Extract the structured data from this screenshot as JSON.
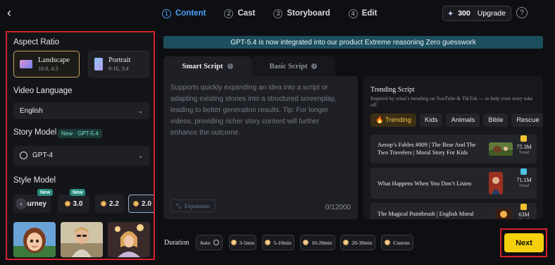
{
  "header": {
    "back_icon": "chevron-left-icon",
    "steps": [
      {
        "num": "1",
        "label": "Content"
      },
      {
        "num": "2",
        "label": "Cast"
      },
      {
        "num": "3",
        "label": "Storyboard"
      },
      {
        "num": "4",
        "label": "Edit"
      }
    ],
    "active_step": 1,
    "credits": "300",
    "upgrade_label": "Upgrade",
    "help_label": "?"
  },
  "left_panel": {
    "aspect_ratio": {
      "title": "Aspect Ratio",
      "options": [
        {
          "name": "Landscape",
          "ratio": "16:9, 4:3",
          "selected": true
        },
        {
          "name": "Portrait",
          "ratio": "9:16, 3:4",
          "selected": false
        }
      ]
    },
    "video_language": {
      "title": "Video Language",
      "value": "English"
    },
    "story_model": {
      "title": "Story Model",
      "badge": "New · GPT-5.4",
      "value": "GPT-4"
    },
    "style_model": {
      "title": "Style Model",
      "chips": [
        {
          "label": "Journey",
          "new": true
        },
        {
          "label": "3.0",
          "new": true
        },
        {
          "label": "2.2",
          "new": false
        },
        {
          "label": "2.0",
          "new": false,
          "selected": true
        }
      ],
      "new_badge": "New",
      "carousel_prev": "‹"
    }
  },
  "main": {
    "banner": "GPT-5.4 is now integrated into our product Extreme reasoning Zero guesswork",
    "tabs": [
      {
        "label": "Smart Script",
        "active": true
      },
      {
        "label": "Basic Script",
        "active": false
      }
    ],
    "editor": {
      "placeholder": "Supports quickly expanding an idea into a script or adapting existing stories into a structured screenplay, leading to better generation results. Tip: For longer videos, providing richer story content will further enhance the outcome.",
      "expansion_label": "Expansion",
      "counter": "0/12000"
    },
    "trending": {
      "title": "Trending Script",
      "subtitle": "Inspired by what’s trending on YouTube & TikTok — to help your story take off.",
      "tabs": [
        "Trending",
        "Kids",
        "Animals",
        "Bible",
        "Rescue"
      ],
      "trend_label": "Trend",
      "items": [
        {
          "title": "Aesop’s Fables #009 | The Bear And The Two Travelers | Moral Story For Kids",
          "views": "75.3M",
          "mark_color": "#f2c230"
        },
        {
          "title": "What Happens When You Don’t Listen",
          "views": "71.1M",
          "mark_color": "#4fc3e8"
        },
        {
          "title": "The Magical Paintbrush | English Moral Animated Kids Story | Fairy Tale",
          "views": "63M",
          "mark_color": "#f2c230"
        }
      ]
    },
    "duration": {
      "label": "Duration",
      "options": [
        "Auto",
        "3-5min",
        "5-10min",
        "10-20min",
        "20-30min",
        "Custom"
      ]
    },
    "next_label": "Next"
  },
  "colors": {
    "accent": "#4aa3ff",
    "next_button": "#f5d10d",
    "highlight_frame": "#d3222a",
    "banner": "#1d4e5e"
  }
}
